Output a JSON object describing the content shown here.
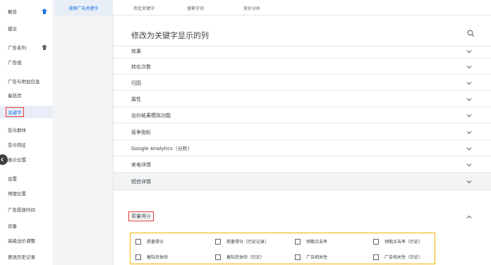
{
  "sidebar": {
    "items": [
      {
        "label": "概览",
        "pinned": true
      },
      {
        "label": "建议",
        "pinned": false
      },
      {
        "label": "广告系列",
        "pinned": true
      },
      {
        "label": "广告组",
        "pinned": false
      },
      {
        "label": "广告与附加信息",
        "pinned": false
      },
      {
        "label": "着陆页",
        "pinned": false
      },
      {
        "label": "关键字",
        "pinned": false,
        "active": true
      },
      {
        "label": "受众群体",
        "pinned": false
      },
      {
        "label": "受众特征",
        "pinned": false
      },
      {
        "label": "展示位置",
        "pinned": false
      },
      {
        "label": "设置",
        "pinned": false
      },
      {
        "label": "地理位置",
        "pinned": false
      },
      {
        "label": "广告投放时间",
        "pinned": false
      },
      {
        "label": "设备",
        "pinned": false
      },
      {
        "label": "高级出价调整",
        "pinned": false
      },
      {
        "label": "更改历史记录",
        "pinned": false
      }
    ]
  },
  "tabs": [
    {
      "label": "搜索广告关键字",
      "active": true
    },
    {
      "label": "否定关键字",
      "active": false
    },
    {
      "label": "搜索字词",
      "active": false
    },
    {
      "label": "竞价分析",
      "active": false
    }
  ],
  "panel": {
    "title": "修改为关键字显示的列",
    "sections": [
      {
        "label": "效果"
      },
      {
        "label": "转化次数"
      },
      {
        "label": "归因"
      },
      {
        "label": "属性"
      },
      {
        "label": "出价结果模拟功能"
      },
      {
        "label": "竞争指标"
      },
      {
        "label": "Google Analytics（分析）"
      },
      {
        "label": "来电详情"
      },
      {
        "label": "短信详情"
      },
      {
        "label": "质量得分",
        "expanded": true
      }
    ],
    "quality_options": [
      {
        "label": "质量得分",
        "checked": false
      },
      {
        "label": "质量得分（历史记录）",
        "checked": false
      },
      {
        "label": "预期点击率",
        "checked": false
      },
      {
        "label": "预期点击率（历史）",
        "checked": false
      },
      {
        "label": "着陆页体验",
        "checked": false
      },
      {
        "label": "着陆页体验（历史）",
        "checked": false
      },
      {
        "label": "广告相关性",
        "checked": false
      },
      {
        "label": "广告相关性（历史）",
        "checked": false
      }
    ]
  },
  "icons": {
    "pin": "pin-icon",
    "search": "search-icon",
    "expand": "chevron-down-icon",
    "collapse": "chevron-up-icon",
    "sidebar_toggle": "chevron-left-icon"
  },
  "colors": {
    "accent": "#1a73e8",
    "highlight_box": "#e53935",
    "options_box": "#f3b400",
    "selected_bg": "#e9eef6",
    "shaded_bg": "#f1f3f4"
  }
}
